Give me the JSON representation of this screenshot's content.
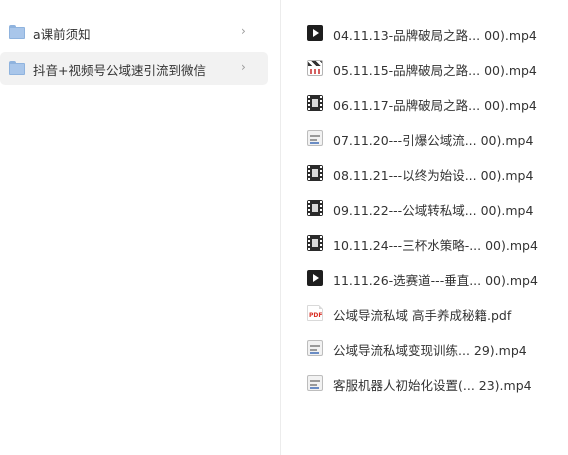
{
  "folders": [
    {
      "label": "a课前须知",
      "selected": false,
      "icon": "folder-icon"
    },
    {
      "label": "抖音+视频号公域速引流到微信",
      "selected": true,
      "icon": "folder-icon"
    }
  ],
  "chevron": "›",
  "files": [
    {
      "label": "04.11.13-品牌破局之路... 00).mp4",
      "icon": "video-dark-icon"
    },
    {
      "label": "05.11.15-品牌破局之路... 00).mp4",
      "icon": "clapper-icon"
    },
    {
      "label": "06.11.17-品牌破局之路... 00).mp4",
      "icon": "film-icon"
    },
    {
      "label": "07.11.20---引爆公域流... 00).mp4",
      "icon": "video-thumb-icon"
    },
    {
      "label": "08.11.21---以终为始设... 00).mp4",
      "icon": "film-icon"
    },
    {
      "label": "09.11.22---公域转私域... 00).mp4",
      "icon": "film-icon"
    },
    {
      "label": "10.11.24---三杯水策略-... 00).mp4",
      "icon": "film-icon"
    },
    {
      "label": "11.11.26-选赛道---垂直... 00).mp4",
      "icon": "video-dark-icon"
    },
    {
      "label": "公域导流私域 高手养成秘籍.pdf",
      "icon": "pdf-icon"
    },
    {
      "label": "公域导流私域变现训练... 29).mp4",
      "icon": "video-thumb-icon"
    },
    {
      "label": "客服机器人初始化设置(... 23).mp4",
      "icon": "video-thumb-icon"
    }
  ],
  "pdf_badge": "PDF",
  "colors": {
    "selected_bg": "#f2f2f2",
    "folder_blue": "#a9c6ea",
    "text": "#333333",
    "divider": "#ececec",
    "pdf_red": "#d93025"
  }
}
